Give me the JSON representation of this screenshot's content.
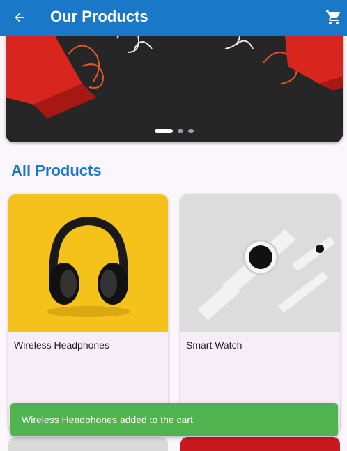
{
  "appbar": {
    "title": "Our Products",
    "back_icon": "arrow-back-icon",
    "cart_icon": "shopping-cart-icon",
    "background": "#1a78c8"
  },
  "banner": {
    "image": "red-shopping-bags-on-black",
    "slide_count": 3,
    "active_slide": 1
  },
  "section": {
    "title": "All Products"
  },
  "products": [
    {
      "name": "Wireless Headphones",
      "image": "black-headphones-on-yellow"
    },
    {
      "name": "Smart Watch",
      "image": "white-smartwatch-on-grey"
    }
  ],
  "snackbar": {
    "message": "Wireless Headphones added to the cart",
    "color": "#4fb34f"
  }
}
